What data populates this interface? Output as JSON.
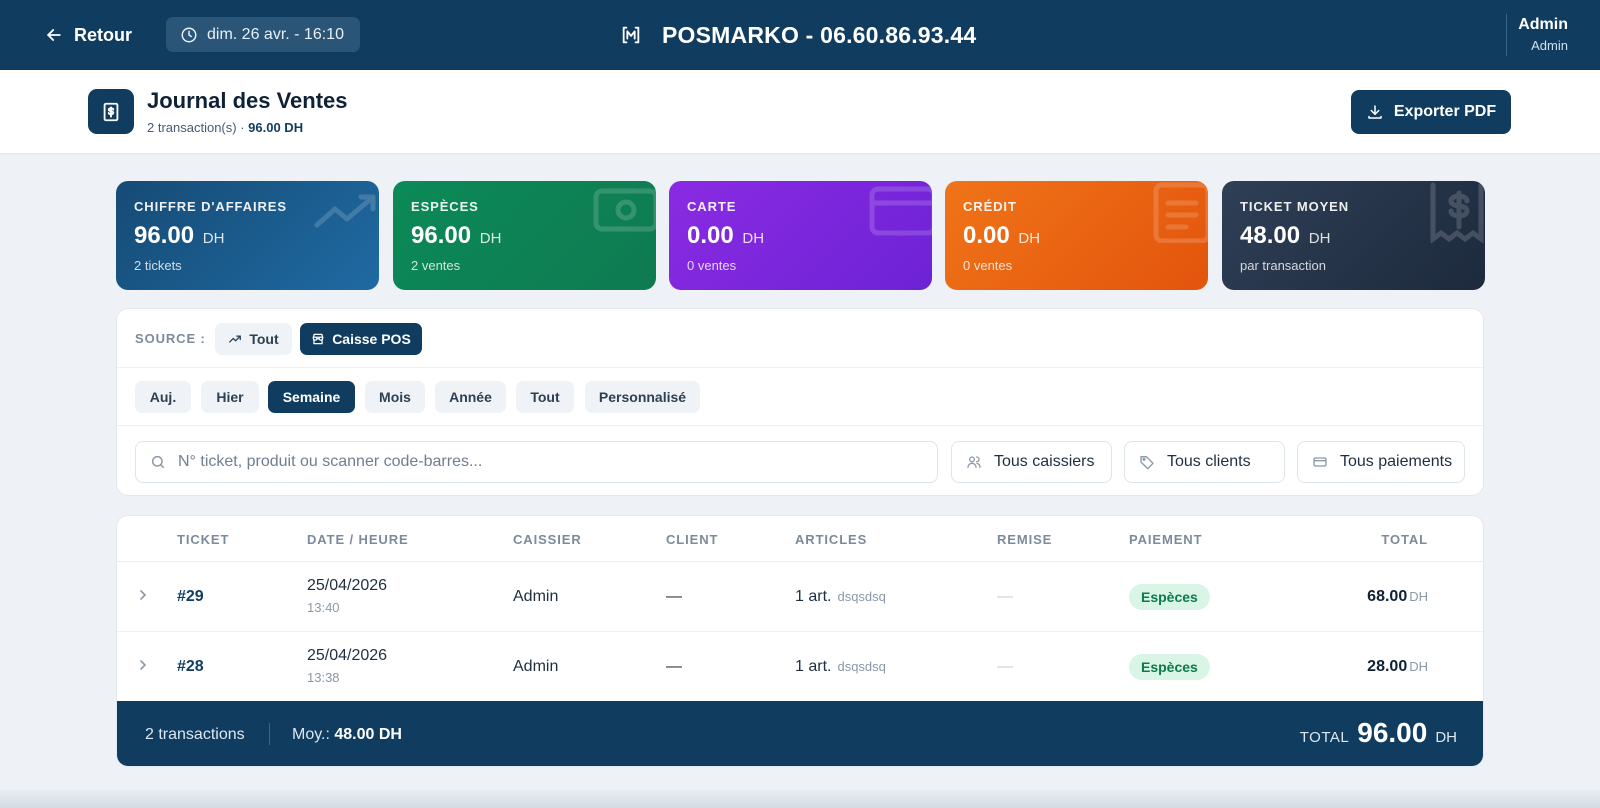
{
  "topbar": {
    "back_label": "Retour",
    "datetime": "dim. 26 avr. - 16:10",
    "brand": "POSMARKO - 06.60.86.93.44",
    "user_name": "Admin",
    "user_role": "Admin"
  },
  "header": {
    "title": "Journal des Ventes",
    "subtitle_count": "2 transaction(s) · ",
    "subtitle_amount": "96.00 DH",
    "export_label": "Exporter PDF"
  },
  "stats": [
    {
      "label": "CHIFFRE D'AFFAIRES",
      "value": "96.00",
      "unit": "DH",
      "sub": "2 tickets"
    },
    {
      "label": "ESPÈCES",
      "value": "96.00",
      "unit": "DH",
      "sub": "2 ventes"
    },
    {
      "label": "CARTE",
      "value": "0.00",
      "unit": "DH",
      "sub": "0 ventes"
    },
    {
      "label": "CRÉDIT",
      "value": "0.00",
      "unit": "DH",
      "sub": "0 ventes"
    },
    {
      "label": "TICKET MOYEN",
      "value": "48.00",
      "unit": "DH",
      "sub": "par transaction"
    }
  ],
  "filters": {
    "source_label": "SOURCE :",
    "source_all": "Tout",
    "source_pos": "Caisse POS",
    "periods": [
      "Auj.",
      "Hier",
      "Semaine",
      "Mois",
      "Année",
      "Tout",
      "Personnalisé"
    ],
    "search_placeholder": "N° ticket, produit ou scanner code-barres...",
    "cashiers": "Tous caissiers",
    "clients": "Tous clients",
    "payments": "Tous paiements"
  },
  "table": {
    "columns": [
      "TICKET",
      "DATE / HEURE",
      "CAISSIER",
      "CLIENT",
      "ARTICLES",
      "REMISE",
      "PAIEMENT",
      "TOTAL"
    ],
    "rows": [
      {
        "ticket": "#29",
        "date": "25/04/2026",
        "time": "13:40",
        "cashier": "Admin",
        "client": "—",
        "articles": "1 art.",
        "article_name": "dsqsdsq",
        "discount": "—",
        "payment": "Espèces",
        "total": "68.00",
        "unit": "DH"
      },
      {
        "ticket": "#28",
        "date": "25/04/2026",
        "time": "13:38",
        "cashier": "Admin",
        "client": "—",
        "articles": "1 art.",
        "article_name": "dsqsdsq",
        "discount": "—",
        "payment": "Espèces",
        "total": "28.00",
        "unit": "DH"
      }
    ],
    "footer": {
      "count": "2 transactions",
      "avg_label": "Moy.: ",
      "avg_value": "48.00 DH",
      "total_label": "TOTAL",
      "total_value": "96.00",
      "total_unit": "DH"
    }
  },
  "colors": {
    "primary": "#103c5f",
    "cash_green": "#0b8a57",
    "card_purple": "#8a2be2",
    "credit_orange": "#f07418",
    "avg_slate": "#2f3f56"
  }
}
